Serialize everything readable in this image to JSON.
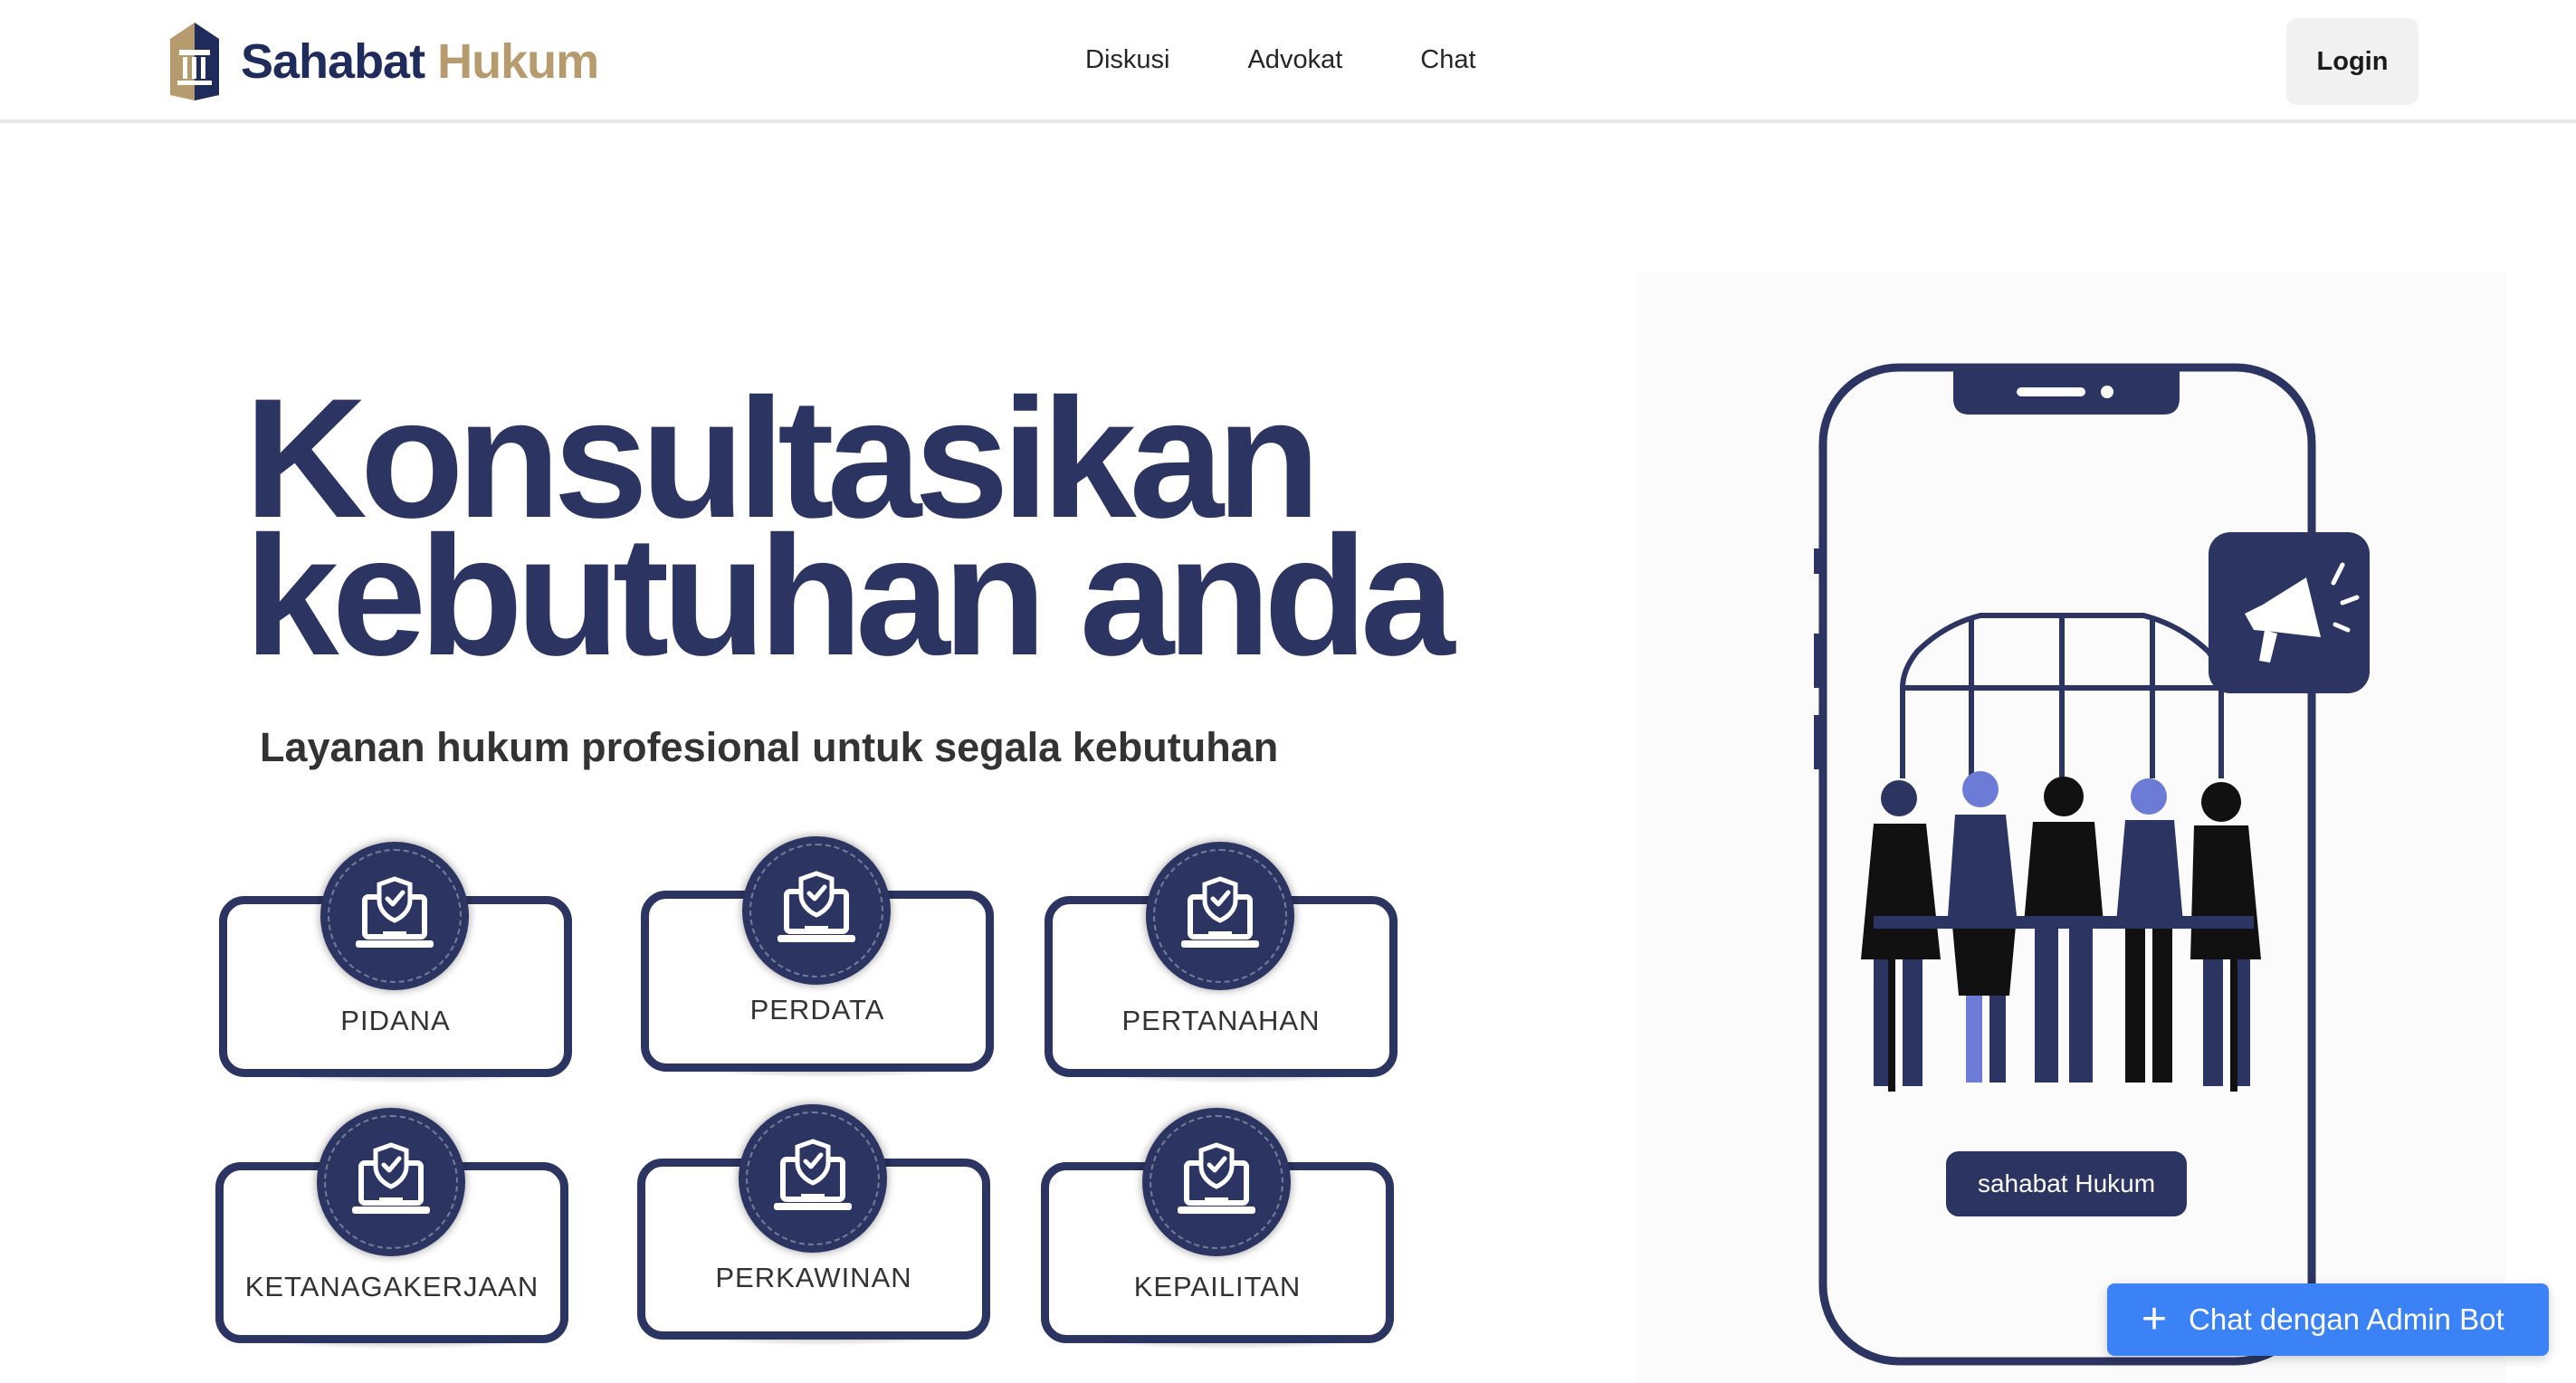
{
  "brand": {
    "name_part1": "Sahabat",
    "name_part2": "Hukum"
  },
  "nav": {
    "links": [
      "Diskusi",
      "Advokat",
      "Chat"
    ],
    "login_label": "Login"
  },
  "hero": {
    "title_line1": "Konsultasikan",
    "title_line2": "kebutuhan anda",
    "subtitle": "Layanan hukum profesional untuk segala kebutuhan"
  },
  "categories": [
    "PIDANA",
    "PERDATA",
    "PERTANAHAN",
    "KETANAGAKERJAAN",
    "PERKAWINAN",
    "KEPAILITAN"
  ],
  "illustration": {
    "pill_label": "sahabat Hukum"
  },
  "chat_bot": {
    "label": "Chat dengan Admin Bot",
    "icon": "plus-icon"
  },
  "colors": {
    "navy": "#2c3561",
    "gold": "#b59b6d",
    "accent_blue": "#3b82f6",
    "person_blue": "#6b7bd6"
  }
}
